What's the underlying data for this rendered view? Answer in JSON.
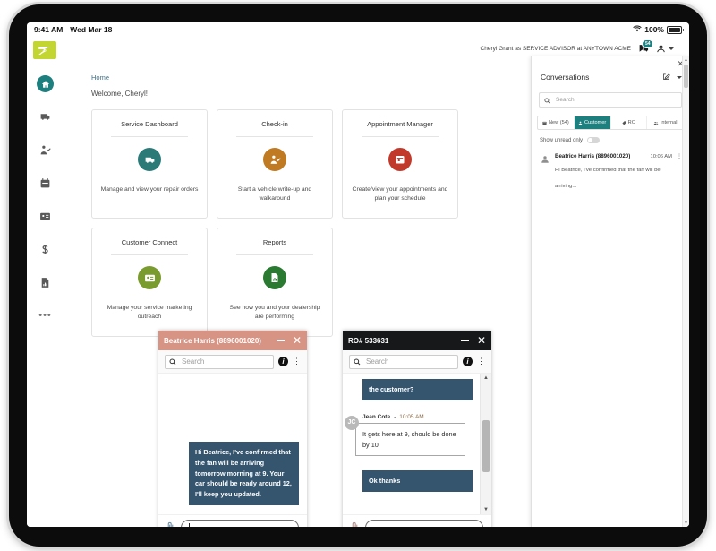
{
  "status_bar": {
    "time": "9:41 AM",
    "date": "Wed Mar 18",
    "battery": "100%",
    "wifi_icon": "wifi-icon",
    "battery_icon": "battery-icon"
  },
  "header": {
    "user_context": "Cheryl Grant as SERVICE ADVISOR at ANYTOWN ACME",
    "messages_icon": "messages-icon",
    "messages_badge": "54",
    "account_icon": "account-icon",
    "account_caret_icon": "chevron-down-icon"
  },
  "sidebar": {
    "logo": "brand-logo",
    "items": [
      {
        "name": "home",
        "icon": "home-icon",
        "active": true
      },
      {
        "name": "service-dashboard",
        "icon": "repair-order-icon",
        "active": false
      },
      {
        "name": "check-in",
        "icon": "vehicle-checkin-icon",
        "active": false
      },
      {
        "name": "appointments",
        "icon": "calendar-icon",
        "active": false
      },
      {
        "name": "customer-connect",
        "icon": "contact-card-icon",
        "active": false
      },
      {
        "name": "payments",
        "icon": "dollar-icon",
        "active": false
      },
      {
        "name": "reports",
        "icon": "report-icon",
        "active": false
      },
      {
        "name": "more",
        "icon": "ellipsis-icon",
        "active": false
      }
    ]
  },
  "main": {
    "breadcrumb": "Home",
    "welcome": "Welcome, Cheryl!",
    "cards": [
      {
        "title": "Service Dashboard",
        "desc": "Manage and view your repair orders",
        "icon": "repair-order-icon",
        "color": "#2b7a78"
      },
      {
        "title": "Check-in",
        "desc": "Start a vehicle write-up and walkaround",
        "icon": "vehicle-checkin-icon",
        "color": "#c07a22"
      },
      {
        "title": "Appointment Manager",
        "desc": "Create/view your appointments and plan your schedule",
        "icon": "calendar-icon",
        "color": "#c0392b"
      },
      {
        "title": "Customer Connect",
        "desc": "Manage your service marketing outreach",
        "icon": "contact-card-icon",
        "color": "#7a9b2e"
      },
      {
        "title": "Reports",
        "desc": "See how you and your dealership are performing",
        "icon": "report-icon",
        "color": "#2a7a32"
      }
    ]
  },
  "conversations_panel": {
    "title": "Conversations",
    "close_icon": "close-icon",
    "compose_icon": "compose-icon",
    "compose_caret_icon": "chevron-down-icon",
    "search_placeholder": "Search",
    "search_value": "",
    "search_icon": "search-icon",
    "tabs": [
      {
        "label": "New (54)",
        "icon": "inbox-icon",
        "active": false
      },
      {
        "label": "Customer",
        "icon": "person-icon",
        "active": true
      },
      {
        "label": "RO",
        "icon": "tag-icon",
        "active": false
      },
      {
        "label": "Internal",
        "icon": "group-icon",
        "active": false
      }
    ],
    "unread_label": "Show unread only",
    "unread_on": false,
    "items": [
      {
        "avatar_icon": "person-avatar-icon",
        "name": "Beatrice Harris (8896001020)",
        "time": "10:06 AM",
        "preview": "Hi Beatrice, I've confirmed that the fan will be arriving...",
        "kebab_icon": "more-vertical-icon"
      }
    ],
    "scrollbar": {
      "up_icon": "caret-up-icon",
      "down_icon": "caret-down-icon"
    }
  },
  "chat_windows": [
    {
      "id": "beatrice",
      "title": "Beatrice Harris (8896001020)",
      "bar_color": "#d79484",
      "minimize_icon": "minimize-icon",
      "close_icon": "close-icon",
      "search_placeholder": "Search",
      "search_value": "",
      "search_icon": "search-icon",
      "info_icon": "info-icon",
      "menu_icon": "more-vertical-icon",
      "messages": [
        {
          "direction": "out",
          "text": "Hi Beatrice, I've confirmed that the fan will be arriving tomorrow morning at 9. Your car should be ready around 12, I'll keep you updated."
        }
      ],
      "compose_value": "",
      "attach_icon": "paperclip-icon",
      "has_scrollbar": false
    },
    {
      "id": "ro533631",
      "title": "RO# 533631",
      "bar_color": "#16181a",
      "minimize_icon": "minimize-icon",
      "close_icon": "close-icon",
      "search_placeholder": "Search",
      "search_value": "",
      "search_icon": "search-icon",
      "info_icon": "info-icon",
      "menu_icon": "more-vertical-icon",
      "messages": [
        {
          "direction": "out",
          "text": "the customer?"
        },
        {
          "direction": "in",
          "sender": "Jean Cote",
          "time": "10:05 AM",
          "avatar_initials": "JC",
          "text": "It gets here at 9, should be done by 10"
        },
        {
          "direction": "out",
          "text": "Ok thanks"
        }
      ],
      "compose_value": "",
      "attach_icon": "paperclip-icon",
      "has_scrollbar": true,
      "scrollbar": {
        "up_icon": "caret-up-icon",
        "down_icon": "caret-down-icon"
      }
    }
  ],
  "colors": {
    "accent_teal": "#1e7f7f",
    "brand_green": "#c3d530",
    "chat_out": "#35556f"
  }
}
